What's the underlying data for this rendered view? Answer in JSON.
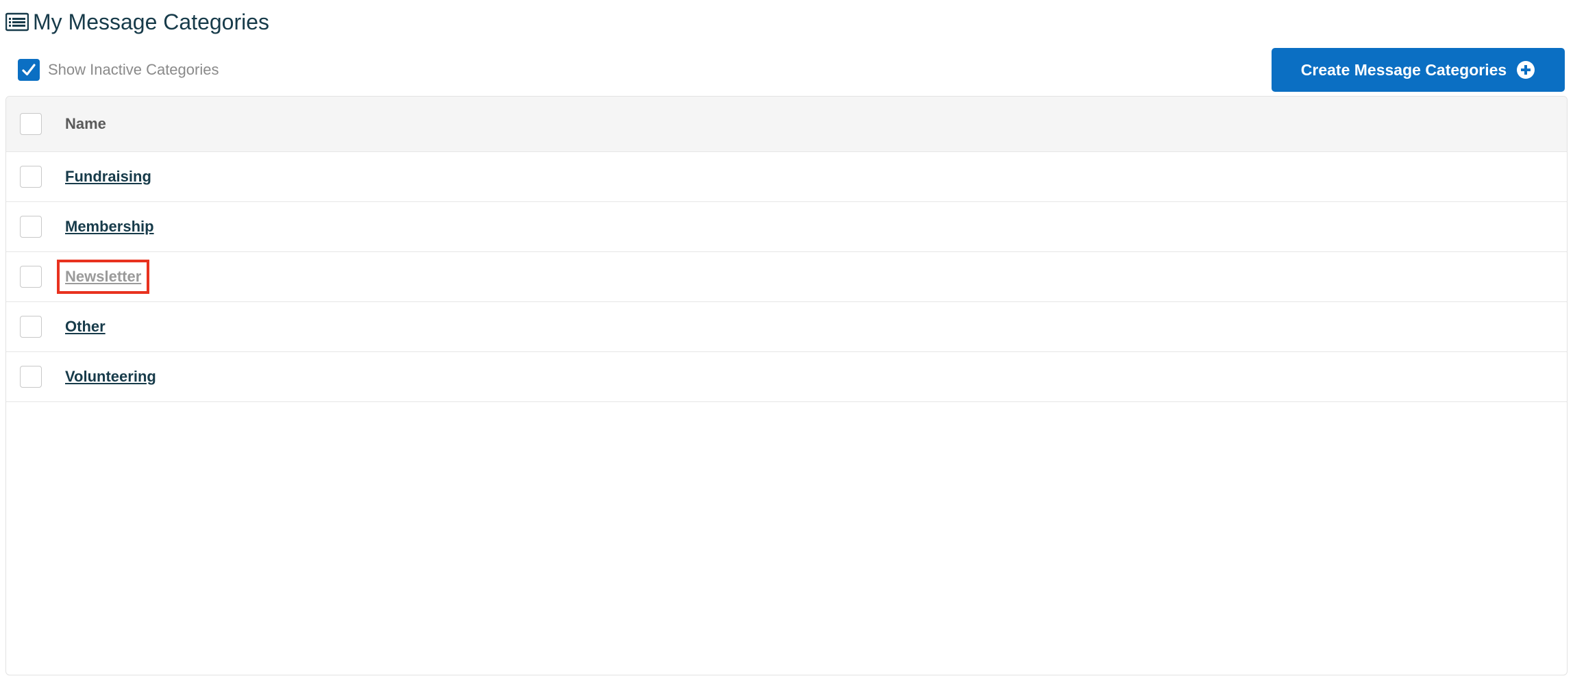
{
  "header": {
    "title": "My Message Categories",
    "icon": "list-icon"
  },
  "toolbar": {
    "show_inactive_label": "Show Inactive Categories",
    "show_inactive_checked": true,
    "create_button_label": "Create Message Categories"
  },
  "table": {
    "columns": [
      {
        "label": "Name"
      }
    ],
    "rows": [
      {
        "name": "Fundraising",
        "active": true
      },
      {
        "name": "Membership",
        "active": true
      },
      {
        "name": "Newsletter",
        "active": false,
        "highlighted": true
      },
      {
        "name": "Other",
        "active": true
      },
      {
        "name": "Volunteering",
        "active": true
      }
    ]
  },
  "colors": {
    "primary": "#0b6fc3",
    "title_text": "#173b4a",
    "inactive_text": "#9a9a9a",
    "highlight_border": "#e8321f"
  }
}
